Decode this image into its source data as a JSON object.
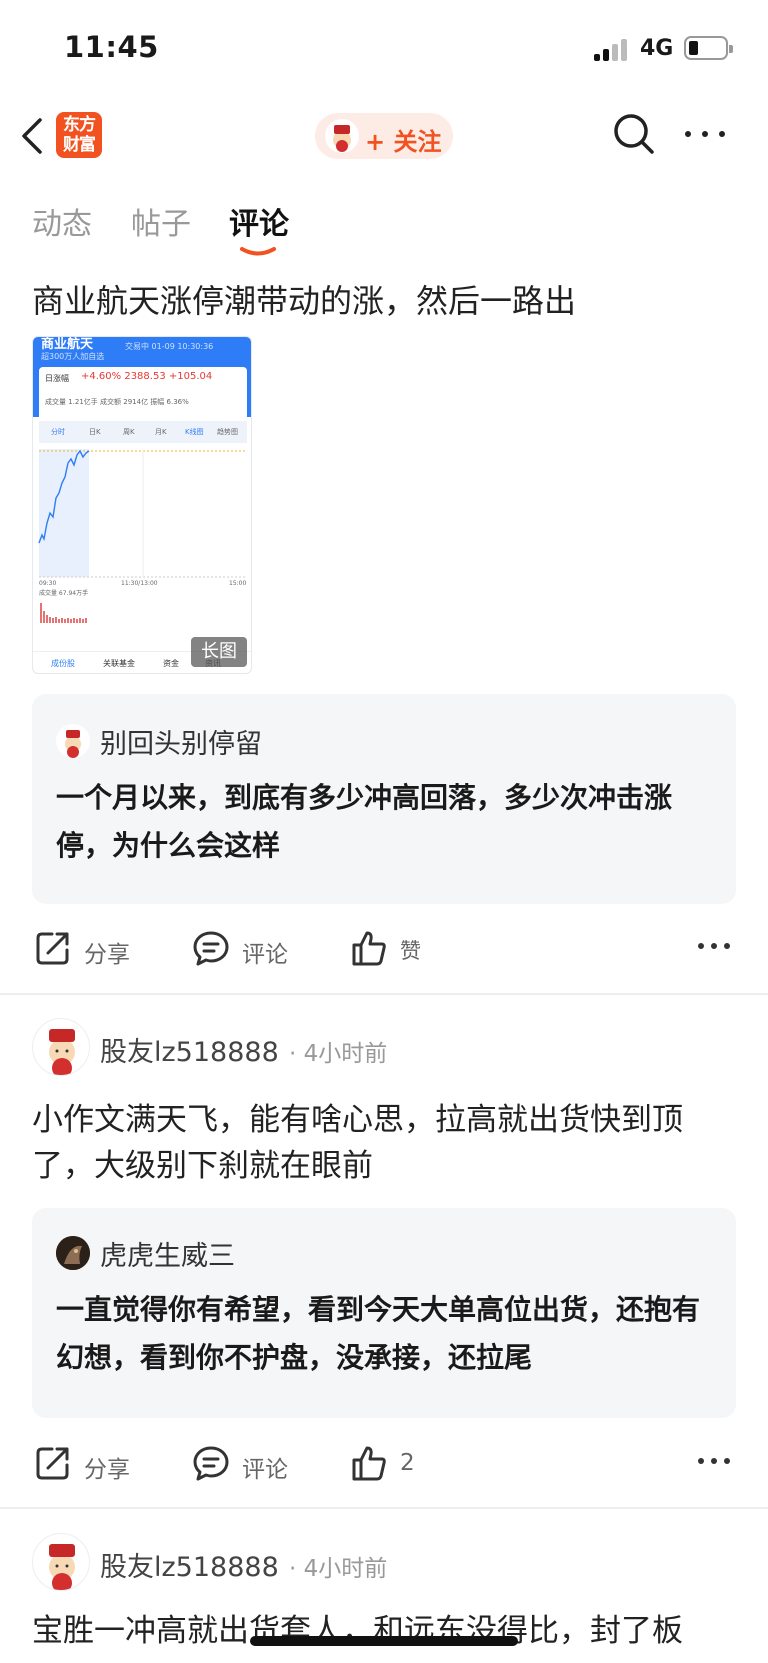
{
  "status": {
    "time": "11:45",
    "network": "4G"
  },
  "nav": {
    "logo_line1": "东方",
    "logo_line2": "财富",
    "follow_label": "+ 关注"
  },
  "tabs": [
    {
      "label": "动态"
    },
    {
      "label": "帖子"
    },
    {
      "label": "评论"
    }
  ],
  "post": {
    "title": "商业航天涨停潮带动的涨，然后一路出",
    "thumbnail": {
      "header_title": "商业航天",
      "header_sub": "交易中 01-09 10:30:36",
      "chip": "超300万人加自选",
      "change_label": "日涨幅",
      "change_value": "+4.60% 2388.53 +105.04",
      "volume_line": "成交量 1.21亿手  成交额 2914亿  振幅 6.36%",
      "chart_tabs": [
        "分时",
        "日K",
        "周K",
        "月K",
        "K线图",
        "趋势图"
      ],
      "time_axis": [
        "09:30",
        "11:30/13:00",
        "15:00"
      ],
      "volume_label": "成交量 67.94万手",
      "footer": [
        "成份股",
        "关联基金",
        "资金",
        "资讯"
      ],
      "badge": "长图"
    },
    "quote": {
      "name": "别回头别停留",
      "text": "一个月以来，到底有多少冲高回落，多少次冲击涨停，为什么会这样"
    },
    "actions": {
      "share": "分享",
      "comment": "评论",
      "like": "赞"
    }
  },
  "comments": [
    {
      "user": "股友lz518888",
      "time": "· 4小时前",
      "text": "小作文满天飞，能有啥心思，拉高就出货快到顶了，大级别下刹就在眼前",
      "quote": {
        "name": "虎虎生威三",
        "text": "一直觉得你有希望，看到今天大单高位出货，还抱有幻想，看到你不护盘，没承接，还拉尾"
      },
      "actions": {
        "share": "分享",
        "comment": "评论",
        "like": "2"
      }
    },
    {
      "user": "股友lz518888",
      "time": "· 4小时前",
      "text": "宝胜一冲高就出货套人，和远东没得比，封了板"
    }
  ],
  "colors": {
    "brand": "#f2521f",
    "chart_blue": "#2e7cf6",
    "quote_bg": "#f5f6f8"
  },
  "icons": [
    "back-arrow-icon",
    "search-icon",
    "more-icon",
    "share-icon",
    "comment-icon",
    "like-icon",
    "caishen-avatar-icon"
  ]
}
